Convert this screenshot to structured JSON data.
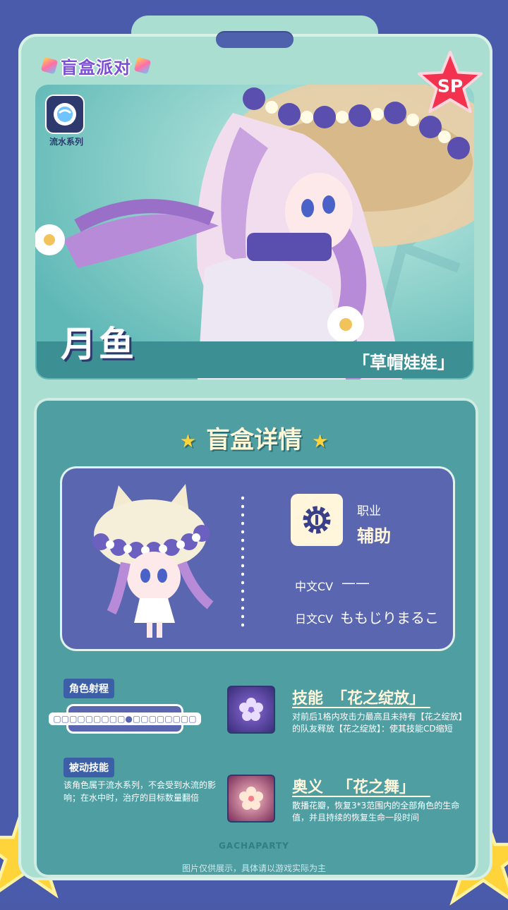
{
  "brand": {
    "logo_text": "盲盒派对",
    "watermark": "GACHAPARTY",
    "rarity_badge": "SP"
  },
  "series": {
    "label": "流水系列",
    "icon": "water-drop-icon"
  },
  "character": {
    "name": "月鱼",
    "title": "「草帽娃娃」"
  },
  "details": {
    "section_title": "盲盒详情",
    "class_label": "职业",
    "class_value": "辅助",
    "class_icon": "gear-wrench-icon",
    "cv_cn_label": "中文CV",
    "cv_cn_value": "——",
    "cv_jp_label": "日文CV",
    "cv_jp_value": "ももじりまるこ"
  },
  "range": {
    "label": "角色射程",
    "cells": "▢▢▢▢▢▢▢▢▢●▢▢▢▢▢▢▢▢"
  },
  "passive": {
    "label": "被动技能",
    "text": "该角色属于流水系列，不会受到水流的影响；在水中时，治疗的目标数量翻倍"
  },
  "skill": {
    "type": "技能",
    "name": "「花之绽放」",
    "desc": "对前后1格内攻击力最高且未持有【花之绽放】的队友释放【花之绽放】：使其技能CD缩短"
  },
  "ultimate": {
    "type": "奥义",
    "name": "「花之舞」",
    "desc": "散播花瓣，恢复3*3范围内的全部角色的生命值，并且持续的恢复生命一段时间"
  },
  "footer": {
    "note": "图片仅供展示，具体请以游戏实际为主"
  },
  "colors": {
    "card": "#a9ded0",
    "panel": "#4f9ea2",
    "info": "#5a66b0",
    "accent": "#ffd43a",
    "background": "#4b5bab"
  }
}
